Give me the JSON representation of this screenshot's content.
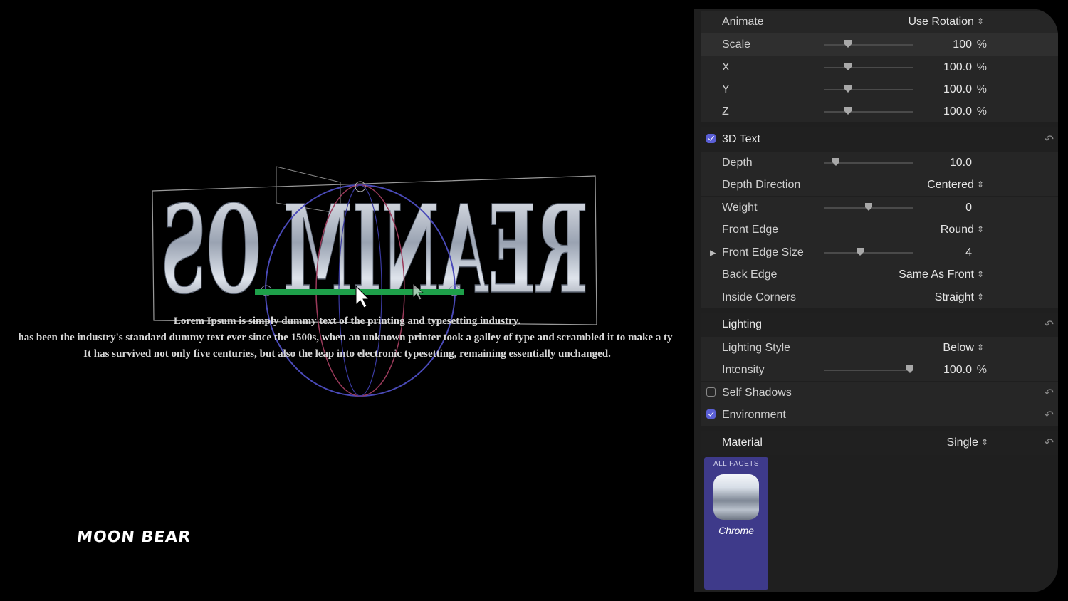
{
  "viewer": {
    "title_3d": "REANIM OS",
    "overlay_lines": [
      "Lorem Ipsum is simply dummy text of the printing and typesetting industry.",
      "has been the industry's standard dummy text ever since the 1500s, when an unknown printer took a galley of type and scrambled it to make a ty",
      "It has survived not only five centuries, but also the leap into electronic typesetting, remaining essentially unchanged."
    ],
    "logo": "MOON BEAR"
  },
  "inspector": {
    "animate": {
      "label": "Animate",
      "value": "Use Rotation"
    },
    "scale": {
      "label": "Scale",
      "value": "100",
      "unit": "%",
      "level": 0.27
    },
    "x": {
      "label": "X",
      "value": "100.0",
      "unit": "%",
      "level": 0.27
    },
    "y": {
      "label": "Y",
      "value": "100.0",
      "unit": "%",
      "level": 0.27
    },
    "z": {
      "label": "Z",
      "value": "100.0",
      "unit": "%",
      "level": 0.27
    },
    "text3d": {
      "label": "3D Text",
      "checked": true
    },
    "depth": {
      "label": "Depth",
      "value": "10.0",
      "level": 0.13
    },
    "depth_direction": {
      "label": "Depth Direction",
      "value": "Centered"
    },
    "weight": {
      "label": "Weight",
      "value": "0",
      "level": 0.5
    },
    "front_edge": {
      "label": "Front Edge",
      "value": "Round"
    },
    "front_edge_size": {
      "label": "Front Edge Size",
      "value": "4",
      "level": 0.4
    },
    "back_edge": {
      "label": "Back Edge",
      "value": "Same As Front"
    },
    "inside_corners": {
      "label": "Inside Corners",
      "value": "Straight"
    },
    "lighting": {
      "label": "Lighting"
    },
    "lighting_style": {
      "label": "Lighting Style",
      "value": "Below"
    },
    "intensity": {
      "label": "Intensity",
      "value": "100.0",
      "unit": "%",
      "level": 0.97
    },
    "self_shadows": {
      "label": "Self Shadows",
      "checked": false
    },
    "environment": {
      "label": "Environment",
      "checked": true
    },
    "material": {
      "label": "Material",
      "value": "Single"
    },
    "material_tile": {
      "caption": "ALL FACETS",
      "name": "Chrome"
    }
  },
  "colors": {
    "accent": "#5a5fd6",
    "handle_green": "#1ea04a",
    "panel": "#1f1f1f"
  }
}
